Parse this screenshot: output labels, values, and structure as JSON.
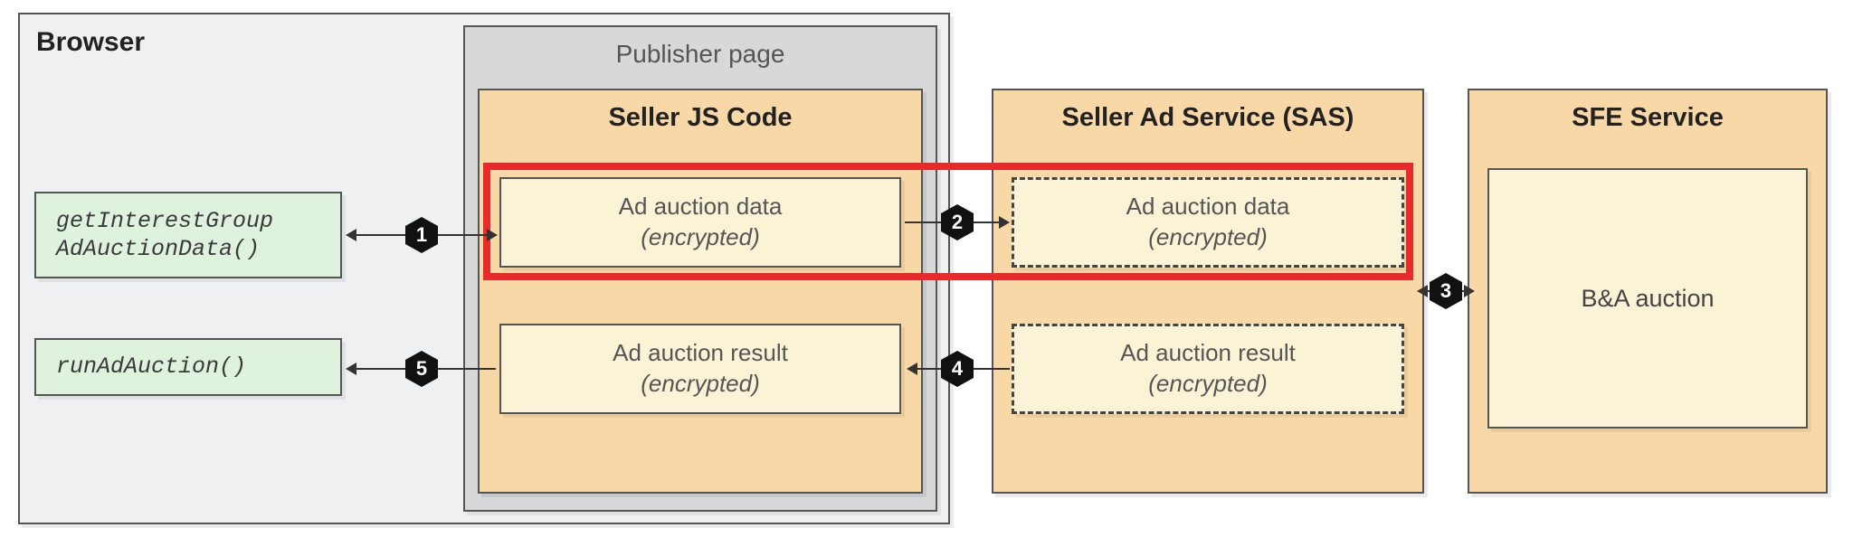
{
  "browser": {
    "title": "Browser"
  },
  "publisher": {
    "title": "Publisher page"
  },
  "functions": {
    "get_data": "getInterestGroup\nAdAuctionData()",
    "run_auction": "runAdAuction()"
  },
  "seller_js": {
    "title": "Seller JS Code",
    "data_box": {
      "line1": "Ad auction data",
      "line2": "(encrypted)"
    },
    "result_box": {
      "line1": "Ad auction result",
      "line2": "(encrypted)"
    }
  },
  "sas": {
    "title": "Seller Ad Service (SAS)",
    "data_box": {
      "line1": "Ad auction data",
      "line2": "(encrypted)"
    },
    "result_box": {
      "line1": "Ad auction result",
      "line2": "(encrypted)"
    }
  },
  "sfe": {
    "title": "SFE Service",
    "body": "B&A auction"
  },
  "steps": {
    "s1": "1",
    "s2": "2",
    "s3": "3",
    "s4": "4",
    "s5": "5"
  }
}
